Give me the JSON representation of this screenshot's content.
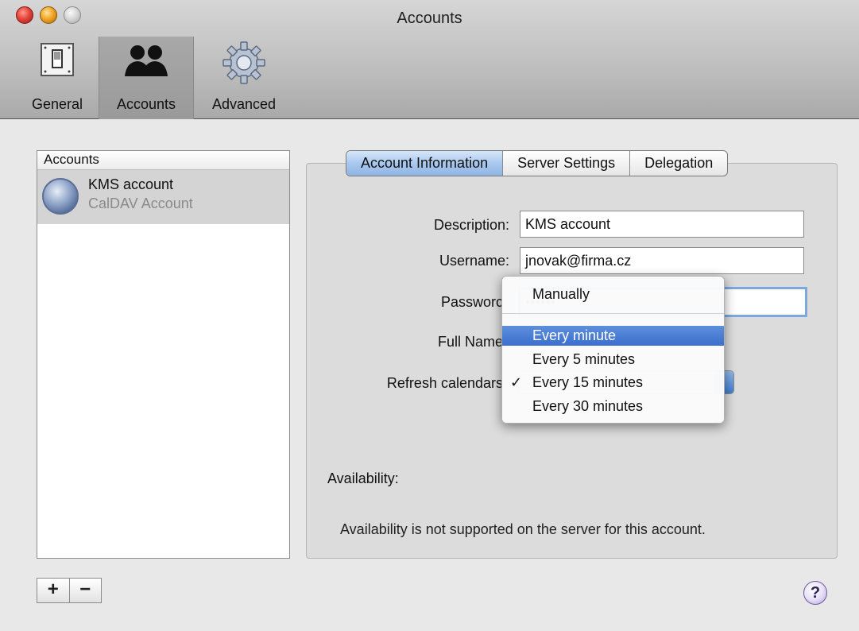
{
  "window": {
    "title": "Accounts"
  },
  "toolbar": {
    "items": [
      {
        "label": "General",
        "icon": "light-switch-icon"
      },
      {
        "label": "Accounts",
        "icon": "people-icon"
      },
      {
        "label": "Advanced",
        "icon": "gear-icon"
      }
    ],
    "selected": "Accounts"
  },
  "sidebar": {
    "header": "Accounts",
    "items": [
      {
        "name": "KMS account",
        "type": "CalDAV Account"
      }
    ],
    "add_label": "+",
    "remove_label": "−"
  },
  "tabs": [
    {
      "label": "Account Information",
      "active": true
    },
    {
      "label": "Server Settings",
      "active": false
    },
    {
      "label": "Delegation",
      "active": false
    }
  ],
  "form": {
    "description_label": "Description:",
    "description_value": "KMS account",
    "username_label": "Username:",
    "username_value": "jnovak@firma.cz",
    "password_label": "Passworc",
    "password_value": "••••••",
    "fullname_label": "Full Name",
    "refresh_label": "Refresh calendars"
  },
  "refresh_menu": {
    "options": [
      "Manually",
      "Every minute",
      "Every 5 minutes",
      "Every 15 minutes",
      "Every 30 minutes"
    ],
    "highlighted": "Every minute",
    "checked": "Every 15 minutes",
    "check_mark": "✓"
  },
  "availability": {
    "title": "Availability:",
    "message": "Availability is not supported on the server for this account."
  },
  "help_label": "?"
}
